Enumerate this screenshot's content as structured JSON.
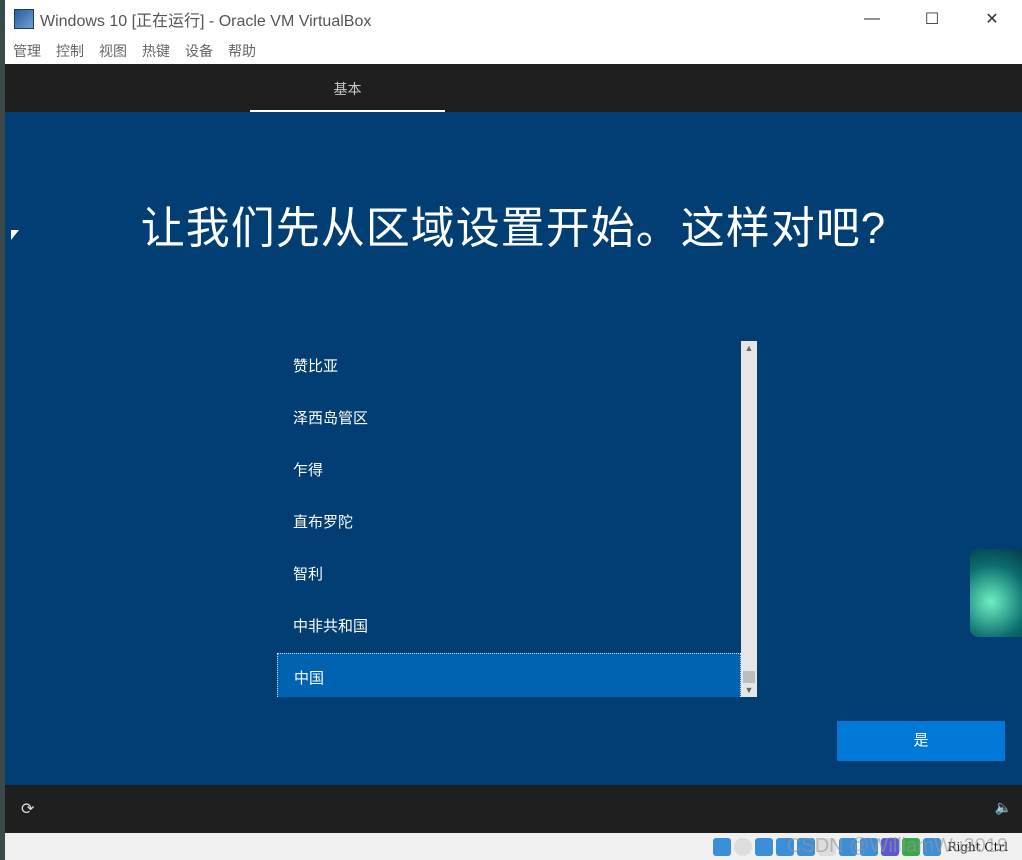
{
  "window": {
    "title": "Windows 10 [正在运行] - Oracle VM VirtualBox",
    "minimize": "—",
    "maximize": "☐",
    "close": "✕"
  },
  "menu": [
    "管理",
    "控制",
    "视图",
    "热键",
    "设备",
    "帮助"
  ],
  "tab": "基本",
  "heading": "让我们先从区域设置开始。这样对吧?",
  "regions": [
    "赞比亚",
    "泽西岛管区",
    "乍得",
    "直布罗陀",
    "智利",
    "中非共和国",
    "中国"
  ],
  "selected": "中国",
  "yes_button": "是",
  "footer": {
    "accessibility_icon": "⟳",
    "volume_icon": "🔈"
  },
  "status": {
    "host_key": "Right Ctrl",
    "watermark": "CSDN @WilliamWu2019"
  }
}
